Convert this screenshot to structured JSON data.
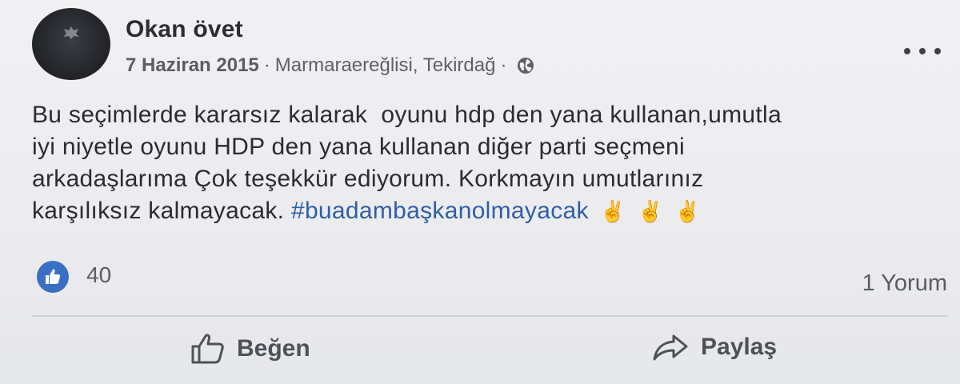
{
  "post": {
    "author": "Okan övet",
    "date": "7 Haziran 2015",
    "separator": "·",
    "location": "Marmaraereğlisi, Tekirdağ",
    "privacy_icon": "globe-icon",
    "menu_icon": "more-dots-icon",
    "text_lines": [
      "Bu seçimlerde kararsız kalarak  oyunu hdp den yana kullanan,umutla",
      "iyi niyetle oyunu HDP den yana kullanan diğer parti seçmeni",
      "arkadaşlarıma Çok teşekkür ediyorum. Korkmayın umutlarınız",
      "karşılıksız kalmayacak. "
    ],
    "hashtag": "#buadambaşkanolmayacak",
    "emojis": [
      "✌",
      "✌",
      "✌"
    ]
  },
  "reactions": {
    "icon": "thumbs-up-icon",
    "count": "40"
  },
  "comments": {
    "label": "1 Yorum"
  },
  "actions": {
    "like_label": "Beğen",
    "like_icon": "thumbs-up-outline-icon",
    "share_label": "Paylaş",
    "share_icon": "share-arrow-icon"
  },
  "colors": {
    "hashtag": "#2f5fa6",
    "like_badge": "#3b6fc4",
    "text": "#2a2c30"
  }
}
